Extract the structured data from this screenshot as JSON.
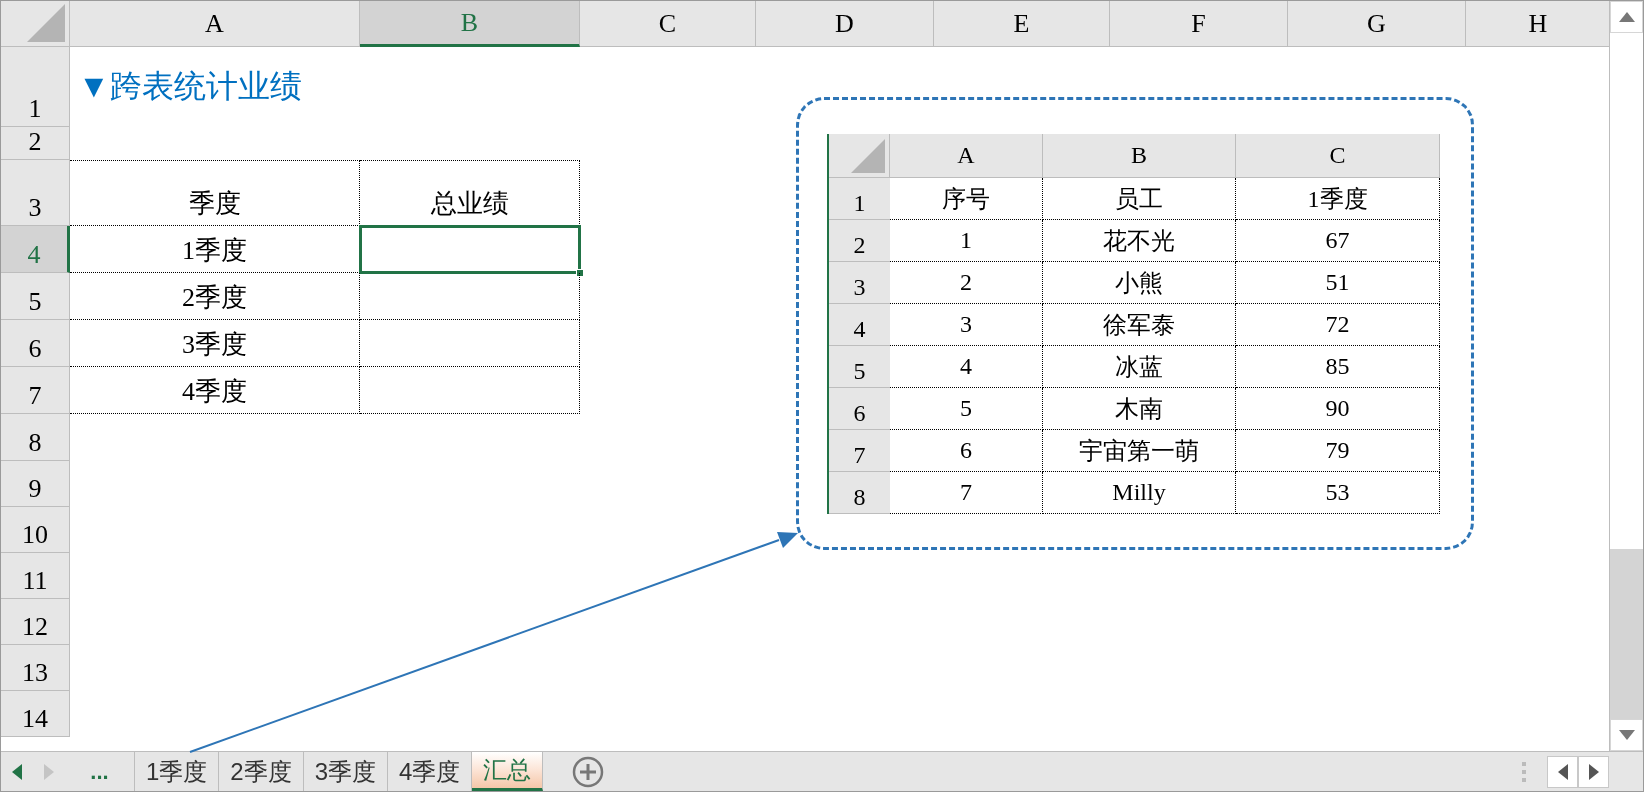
{
  "columns": [
    {
      "label": "A",
      "selected": false
    },
    {
      "label": "B",
      "selected": true
    },
    {
      "label": "C",
      "selected": false
    },
    {
      "label": "D",
      "selected": false
    },
    {
      "label": "E",
      "selected": false
    },
    {
      "label": "F",
      "selected": false
    },
    {
      "label": "G",
      "selected": false
    },
    {
      "label": "H",
      "selected": false
    }
  ],
  "row_headers": [
    {
      "label": "1",
      "selected": false
    },
    {
      "label": "2",
      "selected": false
    },
    {
      "label": "3",
      "selected": false
    },
    {
      "label": "4",
      "selected": true
    },
    {
      "label": "5",
      "selected": false
    },
    {
      "label": "6",
      "selected": false
    },
    {
      "label": "7",
      "selected": false
    },
    {
      "label": "8",
      "selected": false
    },
    {
      "label": "9",
      "selected": false
    },
    {
      "label": "10",
      "selected": false
    },
    {
      "label": "11",
      "selected": false
    },
    {
      "label": "12",
      "selected": false
    },
    {
      "label": "13",
      "selected": false
    },
    {
      "label": "14",
      "selected": false
    }
  ],
  "title": "▼跨表统计业绩",
  "table": {
    "headers": [
      "季度",
      "总业绩"
    ],
    "rows": [
      {
        "quarter": "1季度",
        "active": true
      },
      {
        "quarter": "2季度",
        "active": false
      },
      {
        "quarter": "3季度",
        "active": false
      },
      {
        "quarter": "4季度",
        "active": false
      }
    ]
  },
  "inset": {
    "columns": [
      "A",
      "B",
      "C"
    ],
    "row_numbers": [
      "1",
      "2",
      "3",
      "4",
      "5",
      "6",
      "7",
      "8"
    ],
    "headers": [
      "序号",
      "员工",
      "1季度"
    ],
    "rows": [
      [
        "1",
        "花不光",
        "67"
      ],
      [
        "2",
        "小熊",
        "51"
      ],
      [
        "3",
        "徐军泰",
        "72"
      ],
      [
        "4",
        "冰蓝",
        "85"
      ],
      [
        "5",
        "木南",
        "90"
      ],
      [
        "6",
        "宇宙第一萌",
        "79"
      ],
      [
        "7",
        "Milly",
        "53"
      ]
    ]
  },
  "sheet_tabs": {
    "more": "...",
    "tabs": [
      {
        "label": "1季度",
        "selected": false
      },
      {
        "label": "2季度",
        "selected": false
      },
      {
        "label": "3季度",
        "selected": false
      },
      {
        "label": "4季度",
        "selected": false
      },
      {
        "label": "汇总",
        "selected": true
      }
    ]
  }
}
